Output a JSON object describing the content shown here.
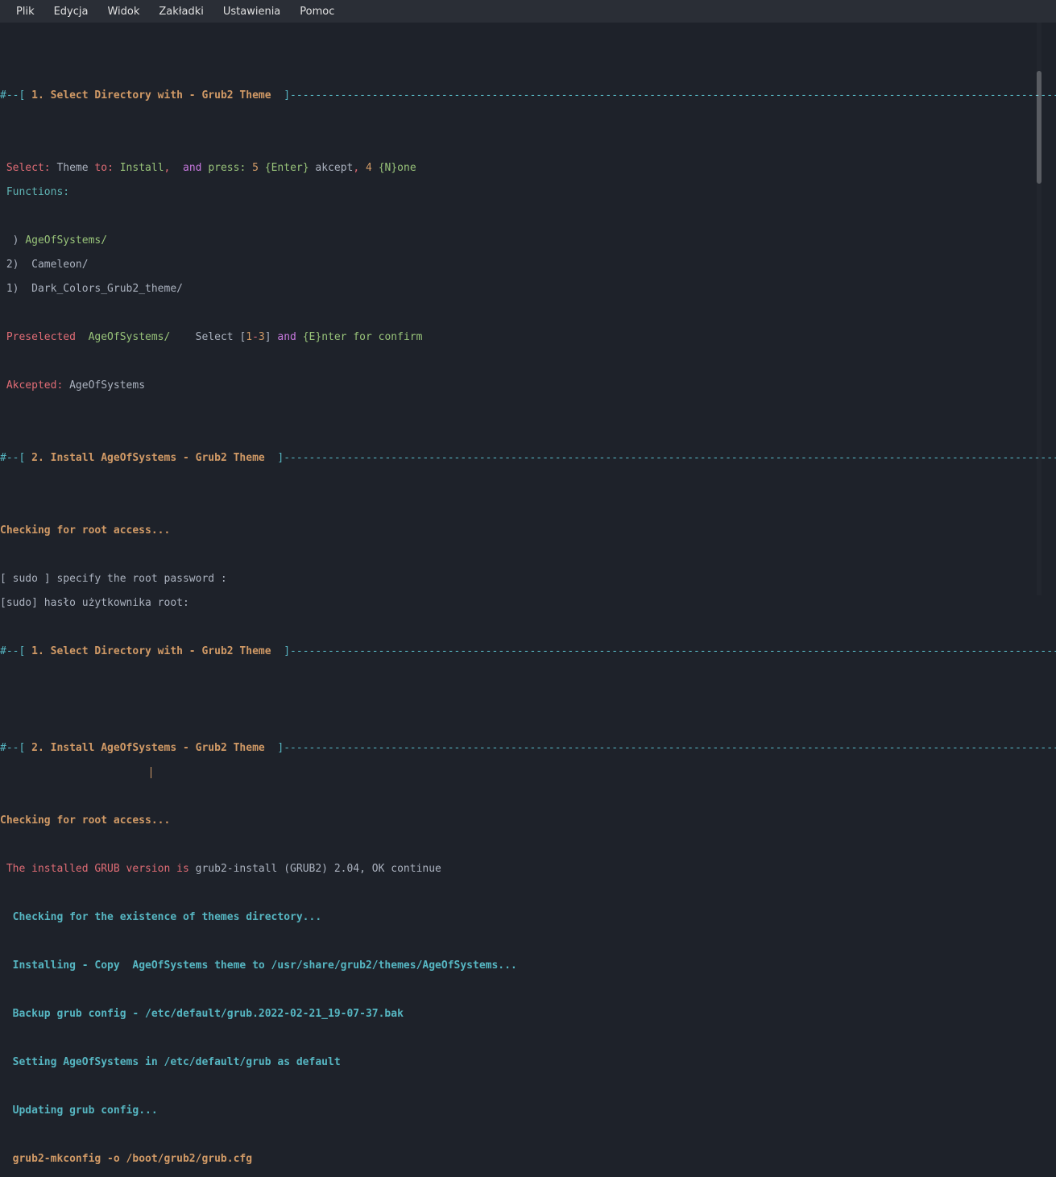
{
  "menu": {
    "items": [
      "Plik",
      "Edycja",
      "Widok",
      "Zakładki",
      "Ustawienia",
      "Pomoc"
    ]
  },
  "section1": {
    "title": "1. Select Directory with - Grub2 Theme",
    "select_label": "Select:",
    "theme": "Theme",
    "to": "to:",
    "install": "Install",
    "comma": ",",
    "and": "and",
    "press": "press:",
    "five": "5",
    "enter": "{Enter}",
    "akcept": "akcept",
    "four": "4",
    "none": "{N}one",
    "functions": "Functions:",
    "items": [
      {
        "num": "  )",
        "name": "AgeOfSystems/"
      },
      {
        "num": " 2) ",
        "name": "Cameleon/"
      },
      {
        "num": " 1) ",
        "name": "Dark_Colors_Grub2_theme/"
      }
    ],
    "preselected": "Preselected",
    "presel_val": "AgeOfSystems/",
    "select2": "Select",
    "bracket_open": "[",
    "range1": "1",
    "dash": "-",
    "range3": "3",
    "bracket_close": "]",
    "and2": "and",
    "enter2": "{E}nter for confirm",
    "akcepted": "Akcepted:",
    "akcepted_val": "AgeOfSystems"
  },
  "section2": {
    "title": "2. Install AgeOfSystems - Grub2 Theme",
    "checking": "Checking for root access...",
    "sudo_line": "[ sudo ] specify the root password :",
    "sudo_prompt": "[sudo] hasło użytkownika root:"
  },
  "section3": {
    "title": "1. Select Directory with - Grub2 Theme"
  },
  "section4": {
    "title": "2. Install AgeOfSystems - Grub2 Theme",
    "checking": "Checking for root access...",
    "grub_version_label": "The installed GRUB version is",
    "grub_version_val": "grub2-install (GRUB2) 2.04, OK continue",
    "checking_themes": "Checking for the existence of themes directory...",
    "installing": "Installing - Copy  AgeOfSystems theme to /usr/share/grub2/themes/AgeOfSystems...",
    "backup": "Backup grub config - /etc/default/grub.2022-02-21_19-07-37.bak",
    "setting": "Setting AgeOfSystems in /etc/default/grub as default",
    "updating": "Updating grub config...",
    "mkconfig": "grub2-mkconfig -o /boot/grub2/grub.cfg"
  }
}
